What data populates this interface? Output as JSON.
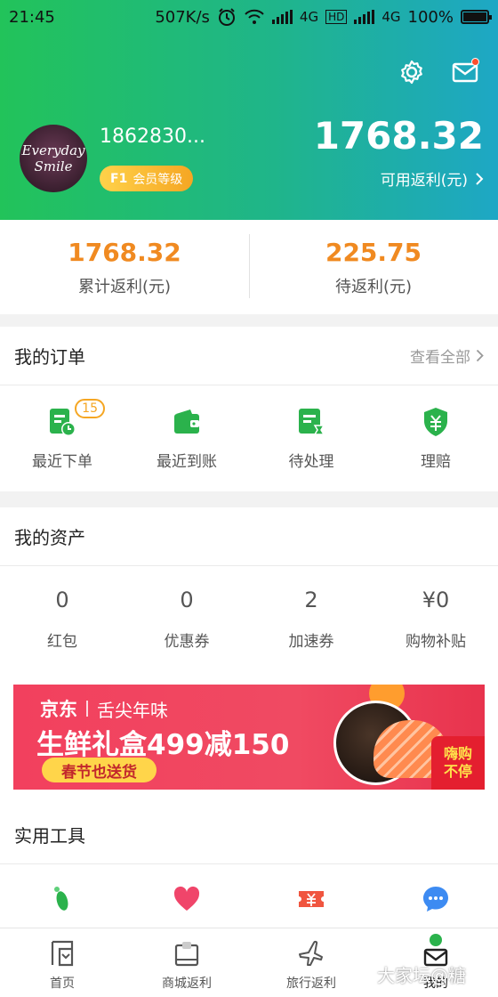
{
  "status_bar": {
    "time": "21:45",
    "speed": "507K/s",
    "net1": "4G",
    "hd": "HD",
    "net2": "4G",
    "battery": "100%"
  },
  "profile": {
    "avatar_text_line1": "Everyday",
    "avatar_text_line2": "Smile",
    "phone": "1862830...",
    "level_prefix": "F1",
    "level_label": "会员等级",
    "balance": "1768.32",
    "balance_label": "可用返利(元)"
  },
  "stats": [
    {
      "value": "1768.32",
      "label": "累计返利(元)"
    },
    {
      "value": "225.75",
      "label": "待返利(元)"
    }
  ],
  "orders": {
    "title": "我的订单",
    "more": "查看全部",
    "items": [
      {
        "label": "最近下单",
        "badge": "15",
        "icon": "recent-order-icon"
      },
      {
        "label": "最近到账",
        "icon": "wallet-icon"
      },
      {
        "label": "待处理",
        "icon": "pending-icon"
      },
      {
        "label": "理赔",
        "icon": "claim-shield-icon"
      }
    ]
  },
  "assets": {
    "title": "我的资产",
    "items": [
      {
        "value": "0",
        "label": "红包"
      },
      {
        "value": "0",
        "label": "优惠券"
      },
      {
        "value": "2",
        "label": "加速券"
      },
      {
        "value": "¥0",
        "label": "购物补贴"
      }
    ]
  },
  "banner": {
    "brand": "京东",
    "tagline": "舌尖年味",
    "headline": "生鲜礼盒499减150",
    "button": "春节也送货",
    "stamp_line1": "嗨购",
    "stamp_line2": "不停"
  },
  "tools": {
    "title": "实用工具",
    "icons": [
      "footprint-icon",
      "heart-icon",
      "ticket-icon",
      "chat-icon"
    ]
  },
  "bottom_nav": [
    {
      "label": "首页",
      "icon": "home-icon"
    },
    {
      "label": "商城返利",
      "icon": "mall-icon"
    },
    {
      "label": "旅行返利",
      "icon": "plane-icon"
    },
    {
      "label": "我的",
      "icon": "profile-icon",
      "active": true
    }
  ],
  "watermark": "大家坛@糖",
  "colors": {
    "header_start": "#22c35a",
    "header_end": "#1ea7c5",
    "accent_orange": "#f08a21",
    "icon_green": "#2bb24c"
  }
}
